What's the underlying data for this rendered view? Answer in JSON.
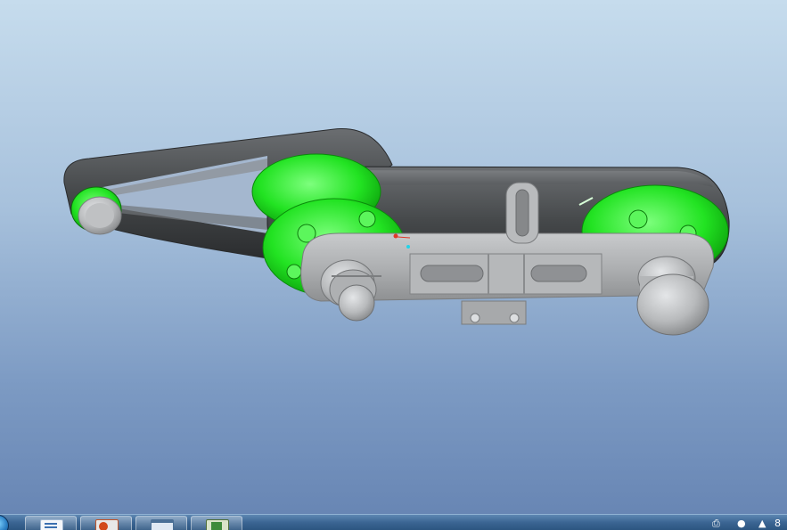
{
  "viewport": {
    "background_top": "#c6dced",
    "background_bottom": "#6886b4"
  },
  "model": {
    "belt_color": "#3d3f41",
    "pulley_color": "#1fe11f",
    "plate_color": "#a9abad",
    "shaft_color": "#c4c6c8"
  },
  "taskbar": {
    "start_icon": "windows-orb-icon",
    "buttons": [
      {
        "name": "explorer-task-button",
        "icon": "list-window-icon"
      },
      {
        "name": "powerpoint-task-button",
        "icon": "powerpoint-icon"
      },
      {
        "name": "window-task-button",
        "icon": "window-icon"
      },
      {
        "name": "cad-task-button",
        "icon": "cad-app-icon"
      }
    ],
    "tray_icons": [
      "printer-icon",
      "penguin-icon",
      "tray-overflow-icon"
    ],
    "tray_text": "8"
  }
}
